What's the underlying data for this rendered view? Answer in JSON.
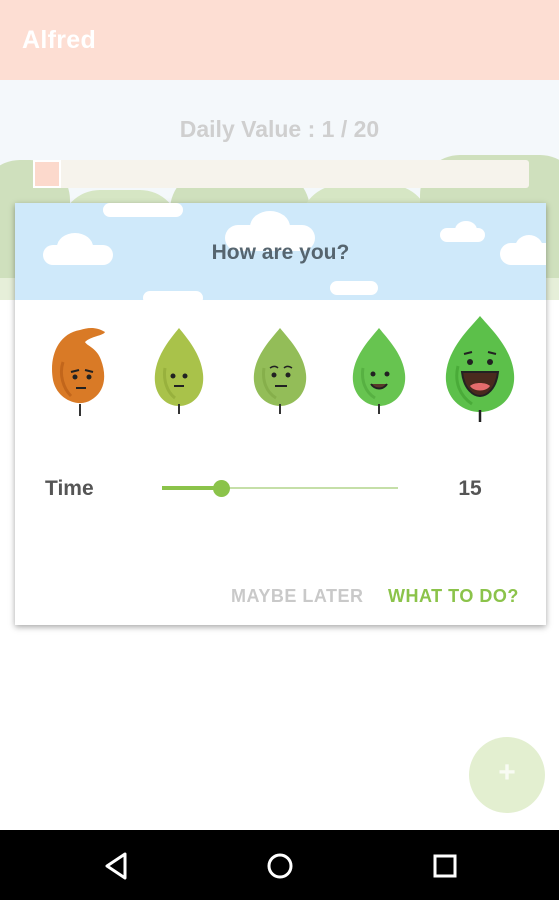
{
  "appbar": {
    "title": "Alfred"
  },
  "background": {
    "daily_value": "Daily Value : 1 / 20",
    "progress": {
      "current": 1,
      "total": 20
    }
  },
  "dialog": {
    "title": "How are you?",
    "moods": [
      {
        "icon": "very-sad-leaf-icon",
        "color": "#d97a26"
      },
      {
        "icon": "sad-leaf-icon",
        "color": "#a9c24a"
      },
      {
        "icon": "neutral-leaf-icon",
        "color": "#93bd58"
      },
      {
        "icon": "happy-leaf-icon",
        "color": "#67c450"
      },
      {
        "icon": "very-happy-leaf-icon",
        "color": "#5cc04a"
      }
    ],
    "time": {
      "label": "Time",
      "value": "15",
      "min": 0,
      "max": 60,
      "level": 15
    },
    "buttons": {
      "later": "MAYBE LATER",
      "what": "WHAT TO DO?"
    }
  },
  "fab": {
    "icon": "plus-icon",
    "label": "+"
  },
  "colors": {
    "accent": "#8bc34a",
    "appbar": "#fdded3",
    "sky": "#cfe9fa"
  },
  "navbar": {
    "icons": [
      "back-icon",
      "home-icon",
      "recents-icon"
    ]
  }
}
